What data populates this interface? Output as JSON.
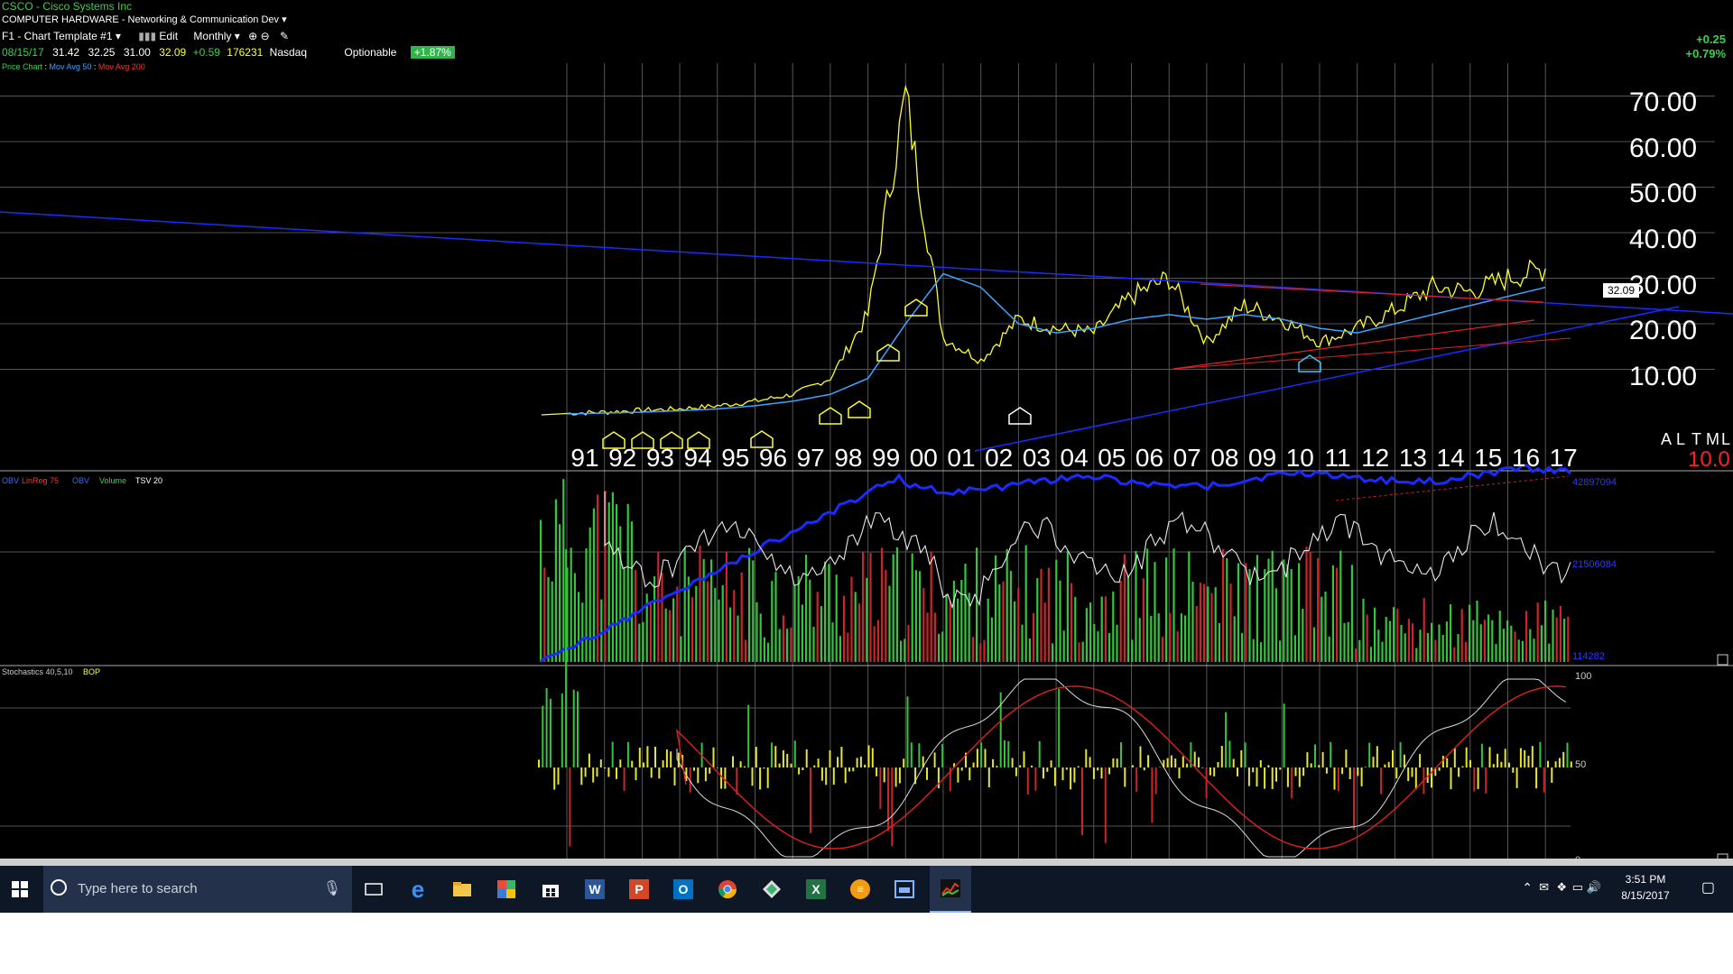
{
  "header": {
    "ticker_line": "CSCO - Cisco Systems Inc",
    "industry": "COMPUTER HARDWARE - Networking & Communication Dev",
    "template": "F1 - Chart Template #1",
    "edit_label": "Edit",
    "period": "Monthly",
    "date": "08/15/17",
    "open": "31.42",
    "high": "32.25",
    "low": "31.00",
    "close": "32.09",
    "change": "+0.59",
    "volume": "176231",
    "exchange": "Nasdaq",
    "optionable": "Optionable",
    "pct_badge": "+1.87%",
    "legend_price": "Price Chart",
    "legend_ma50": "Mov Avg 50",
    "legend_ma200": "Mov Avg 200",
    "change_right": "+0.25",
    "pct_right": "+0.79%"
  },
  "price_panel": {
    "last_price_tag": "32.09",
    "y_ticks": [
      "70.00",
      "60.00",
      "50.00",
      "40.00",
      "30.00",
      "20.00",
      "10.00"
    ],
    "years": [
      "91",
      "92",
      "93",
      "94",
      "95",
      "96",
      "97",
      "98",
      "99",
      "00",
      "01",
      "02",
      "03",
      "04",
      "05",
      "06",
      "07",
      "08",
      "09",
      "10",
      "11",
      "12",
      "13",
      "14",
      "15",
      "16",
      "17"
    ],
    "right_labels": {
      "a": "A",
      "l": "L",
      "t": "T",
      "m": "M",
      "l2": "L",
      "value": "10.0"
    }
  },
  "volume_panel": {
    "legend": [
      "OBV",
      "LinReg 75",
      "OBV",
      "Volume",
      "TSV 20"
    ],
    "right_ticks": [
      "42897094",
      "21506084",
      "114282"
    ]
  },
  "stoch_panel": {
    "legend": "Stochastics 40,5,10",
    "legend_b": "BOP",
    "ticks": [
      "100",
      "50",
      "0"
    ]
  },
  "chart_data": {
    "type": "line",
    "title": "CSCO - Cisco Systems Inc",
    "x": [
      "91",
      "92",
      "93",
      "94",
      "95",
      "96",
      "97",
      "98",
      "99",
      "00",
      "01",
      "02",
      "03",
      "04",
      "05",
      "06",
      "07",
      "08",
      "09",
      "10",
      "11",
      "12",
      "13",
      "14",
      "15",
      "16",
      "17"
    ],
    "series": [
      {
        "name": "Price Chart",
        "values": [
          0.3,
          0.6,
          1.0,
          1.3,
          2.0,
          3.0,
          4.5,
          8.0,
          22.0,
          70.0,
          17.0,
          12.0,
          21.0,
          19.0,
          18.0,
          26.0,
          30.0,
          16.0,
          24.0,
          21.0,
          16.0,
          19.0,
          23.0,
          28.0,
          27.0,
          30.0,
          32.09
        ]
      },
      {
        "name": "Mov Avg 50",
        "values": [
          0.2,
          0.4,
          0.6,
          0.9,
          1.3,
          2.0,
          3.0,
          4.5,
          8.0,
          20.0,
          31.0,
          28.0,
          20.0,
          18.0,
          19.0,
          21.0,
          22.0,
          21.0,
          22.0,
          21.0,
          19.0,
          18.0,
          20.0,
          22.0,
          24.0,
          26.0,
          28.0
        ]
      }
    ],
    "ylim": [
      0,
      80
    ],
    "grid": true
  },
  "taskbar": {
    "search_placeholder": "Type here to search",
    "time": "3:51 PM",
    "date": "8/15/2017"
  }
}
